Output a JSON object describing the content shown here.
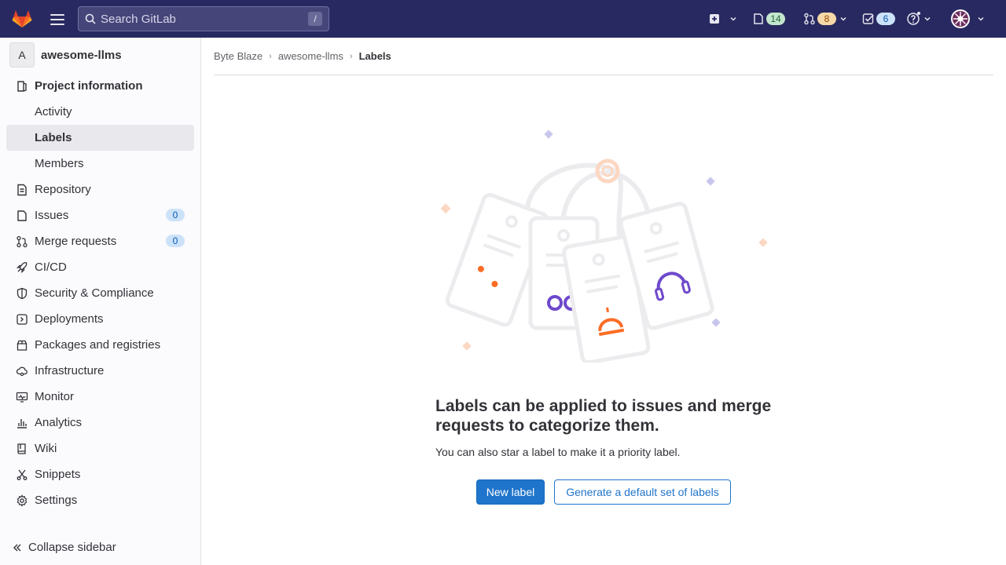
{
  "topbar": {
    "search_placeholder": "Search GitLab",
    "search_shortcut": "/",
    "issues_count": "14",
    "merge_requests_count": "8",
    "todos_count": "6"
  },
  "project": {
    "avatar_letter": "A",
    "name": "awesome-llms"
  },
  "sidebar": {
    "items": [
      {
        "label": "Project information",
        "icon": "project-icon"
      },
      {
        "label": "Activity"
      },
      {
        "label": "Labels"
      },
      {
        "label": "Members"
      },
      {
        "label": "Repository",
        "icon": "doc-icon"
      },
      {
        "label": "Issues",
        "icon": "issues-icon",
        "count": "0"
      },
      {
        "label": "Merge requests",
        "icon": "merge-request-icon",
        "count": "0"
      },
      {
        "label": "CI/CD",
        "icon": "rocket-icon"
      },
      {
        "label": "Security & Compliance",
        "icon": "shield-icon"
      },
      {
        "label": "Deployments",
        "icon": "deployments-icon"
      },
      {
        "label": "Packages and registries",
        "icon": "package-icon"
      },
      {
        "label": "Infrastructure",
        "icon": "cloud-gear-icon"
      },
      {
        "label": "Monitor",
        "icon": "monitor-icon"
      },
      {
        "label": "Analytics",
        "icon": "chart-icon"
      },
      {
        "label": "Wiki",
        "icon": "book-icon"
      },
      {
        "label": "Snippets",
        "icon": "scissors-icon"
      },
      {
        "label": "Settings",
        "icon": "gear-icon"
      }
    ],
    "collapse_label": "Collapse sidebar"
  },
  "breadcrumb": {
    "items": [
      "Byte Blaze",
      "awesome-llms",
      "Labels"
    ]
  },
  "empty_state": {
    "title": "Labels can be applied to issues and merge requests to categorize them.",
    "description": "You can also star a label to make it a priority label.",
    "primary_button": "New label",
    "secondary_button": "Generate a default set of labels"
  },
  "colors": {
    "topbar": "#292961",
    "primary": "#1f75cb",
    "sidebar_bg": "#fbfafd",
    "active_item": "#e9e8ed"
  }
}
